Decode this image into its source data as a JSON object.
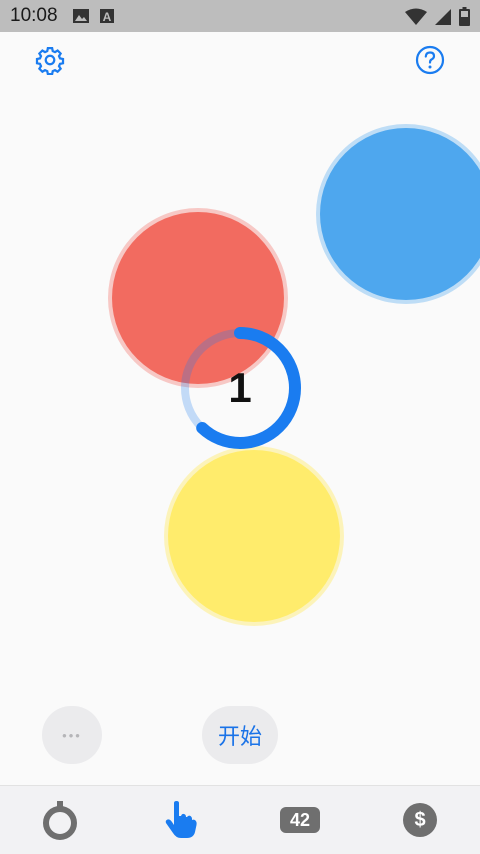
{
  "status_bar": {
    "time": "10:08",
    "icons": [
      "image-icon",
      "a-badge-icon",
      "wifi-icon",
      "signal-icon",
      "battery-icon"
    ]
  },
  "toolbar": {
    "settings_icon": "gear-icon",
    "help_icon": "question-circle-icon"
  },
  "circles": [
    {
      "name": "red",
      "color": "#f26b60"
    },
    {
      "name": "blue",
      "color": "#4ea7ee"
    },
    {
      "name": "yellow",
      "color": "#ffec6c"
    }
  ],
  "counter": {
    "value": "1",
    "progress": 0.62,
    "color": "#1a7cf0"
  },
  "buttons": {
    "start_label": "开始",
    "more_label": "•••"
  },
  "tabs": [
    {
      "name": "timer",
      "icon": "stopwatch-icon"
    },
    {
      "name": "tap",
      "icon": "pointing-hand-icon",
      "active": true
    },
    {
      "name": "number",
      "label": "42"
    },
    {
      "name": "price",
      "label": "$"
    }
  ],
  "accent_color": "#1a7cf0"
}
